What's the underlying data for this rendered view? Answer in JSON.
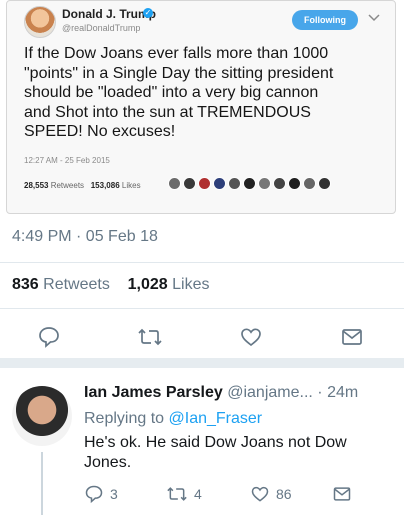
{
  "embedded": {
    "name": "Donald J. Trump",
    "handle": "@realDonaldTrump",
    "follow_label": "Following",
    "text": "If the Dow Joans ever falls more than 1000\n\"points\" in a Single Day the sitting president\nshould be \"loaded\" into a very big cannon\nand Shot into the sun at TREMENDOUS\nSPEED! No excuses!",
    "time": "12:27 AM - 25 Feb 2015",
    "retweets_count": "28,553",
    "retweets_label": "Retweets",
    "likes_count": "153,086",
    "likes_label": "Likes"
  },
  "main": {
    "timestamp": "4:49 PM · 05 Feb 18",
    "retweets_count": "836",
    "retweets_label": "Retweets",
    "likes_count": "1,028",
    "likes_label": "Likes",
    "actions": [
      "reply-icon",
      "retweet-icon",
      "like-icon",
      "message-icon"
    ]
  },
  "reply": {
    "name": "Ian James Parsley",
    "handle": "@ianjame...",
    "dot": "·",
    "time": "24m",
    "replying_prefix": "Replying to",
    "replying_to": "@Ian_Fraser",
    "text": "He's ok. He said Dow Joans not Dow Jones.",
    "reply_count": "3",
    "retweet_count": "4",
    "like_count": "86"
  },
  "colors": {
    "accent": "#1da1f2",
    "gray_text": "#657786"
  }
}
